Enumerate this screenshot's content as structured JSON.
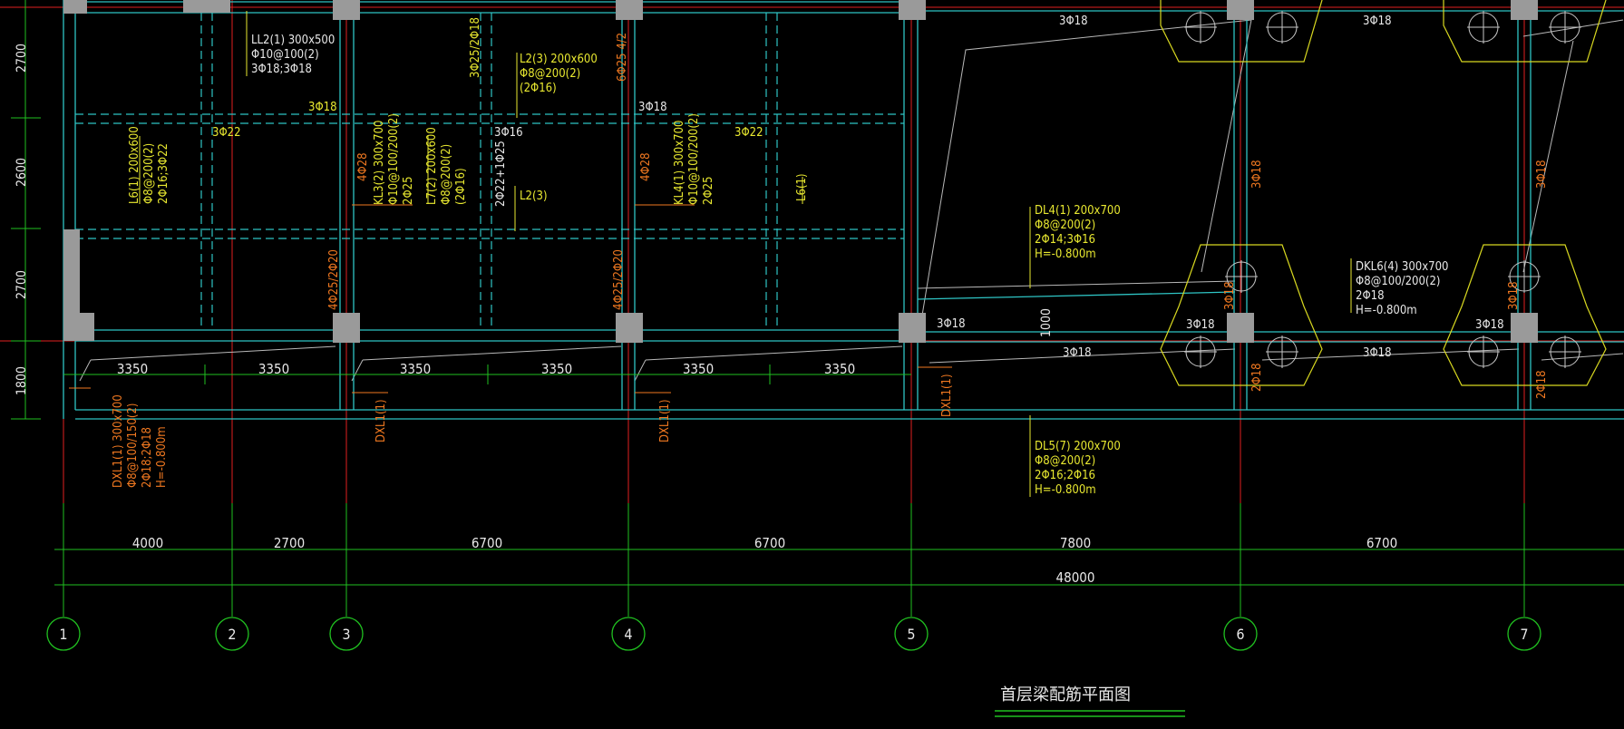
{
  "drawing": {
    "title": "首层梁配筋平面图",
    "colors": {
      "background": "#000000",
      "beam": "#2ec4c4",
      "axis_red": "#e02020",
      "dimension": "#20c020",
      "annotation_yellow": "#e8e830",
      "annotation_orange": "#f07820",
      "column": "#9a9a9a",
      "pile_cap": "#d8d820",
      "white_line": "#c8c8c8"
    }
  },
  "grid_axes": [
    "1",
    "2",
    "3",
    "4",
    "5",
    "6",
    "7"
  ],
  "bay_dims": [
    "4000",
    "2700",
    "6700",
    "6700",
    "7800",
    "6700"
  ],
  "overall_dim": "48000",
  "row_dims": [
    "2700",
    "2600",
    "2700",
    "1800"
  ],
  "sub_dims": [
    "3350",
    "3350",
    "3350",
    "3350",
    "3350",
    "3350"
  ],
  "bar_labels": {
    "t1": "3Φ18",
    "t2": "3Φ22",
    "t3": "3Φ16",
    "t4": "3Φ18",
    "t5": "3Φ22",
    "t6": "3Φ18",
    "t7": "3Φ18",
    "t8": "3Φ18",
    "t9": "3Φ18",
    "t10": "3Φ18",
    "t11": "3Φ18",
    "t12": "3Φ18",
    "v1": "3Φ25/2Φ18",
    "v2": "6Φ25 4/2",
    "v3": "4Φ25/2Φ20",
    "v4": "4Φ25/2Φ20",
    "v5": "4Φ28",
    "v6": "4Φ28",
    "v7": "2Φ22+1Φ25",
    "v8": "3Φ18",
    "v9": "3Φ18",
    "v10": "2Φ18",
    "v11": "2Φ18",
    "v12": "3Φ18",
    "v13": "3Φ18",
    "d1000": "1000"
  },
  "beams": {
    "LL2": [
      "LL2(1) 300x500",
      "Φ10@100(2)",
      "3Φ18;3Φ18"
    ],
    "L2": [
      "L2(3) 200x600",
      "Φ8@200(2)",
      "(2Φ16)"
    ],
    "L6a": [
      "L6(1) 200x600",
      "Φ8@200(2)",
      "2Φ16;3Φ22"
    ],
    "KL3": [
      "KL3(2) 300x700",
      "Φ10@100/200(2)",
      "2Φ25"
    ],
    "L7": [
      "L7(2) 200x600",
      "Φ8@200(2)",
      "(2Φ16)"
    ],
    "L2b": "L2(3)",
    "KL4": [
      "KL4(1) 300x700",
      "Φ10@100/200(2)",
      "2Φ25"
    ],
    "L6b": "L6(1)",
    "DL4": [
      "DL4(1) 200x700",
      "Φ8@200(2)",
      "2Φ14;3Φ16",
      "H=-0.800m"
    ],
    "DKL6": [
      "DKL6(4) 300x700",
      "Φ8@100/200(2)",
      "2Φ18",
      "H=-0.800m"
    ],
    "DXL1": [
      "DXL1(1) 300x700",
      "Φ8@100/150(2)",
      "2Φ18;2Φ18",
      "H=-0.800m"
    ],
    "DXL1b": "DXL1(1)",
    "DXL1c": "DXL1(1)",
    "DXL1d": "DXL1(1)",
    "DL5": [
      "DL5(7) 200x700",
      "Φ8@200(2)",
      "2Φ16;2Φ16",
      "H=-0.800m"
    ]
  }
}
